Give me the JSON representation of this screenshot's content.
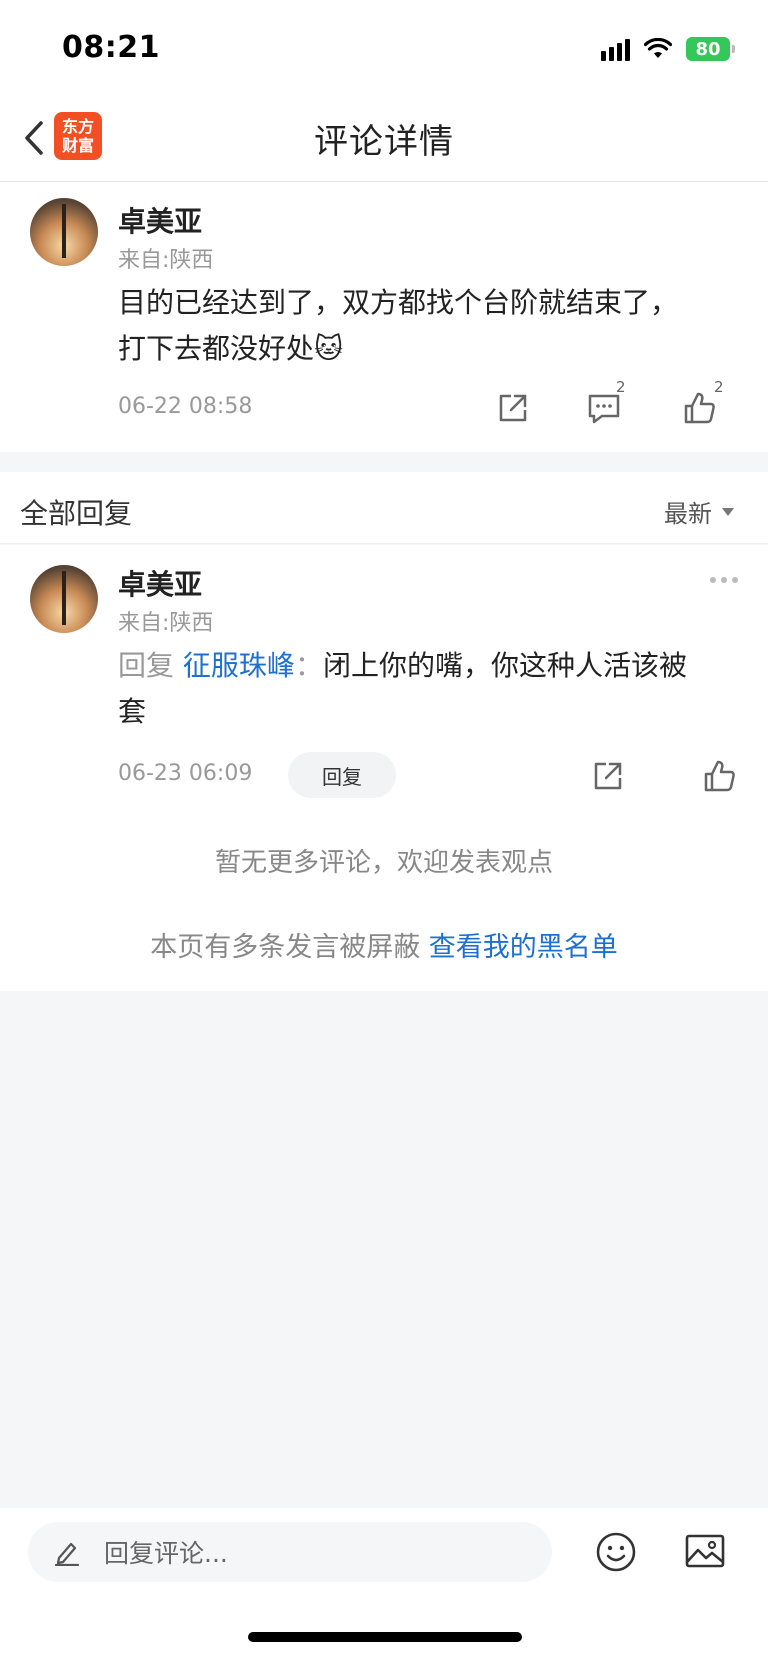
{
  "status_bar": {
    "time": "08:21",
    "battery": "80"
  },
  "nav": {
    "title": "评论详情",
    "logo_line1": "东方",
    "logo_line2": "财富"
  },
  "main_comment": {
    "username": "卓美亚",
    "location": "来自:陕西",
    "text_line1": "目的已经达到了，双方都找个台阶就结束了，",
    "text_line2": "打下去都没好处🐱",
    "time": "06-22 08:58",
    "comment_count": "2",
    "like_count": "2"
  },
  "replies": {
    "title": "全部回复",
    "sort_label": "最新",
    "items": [
      {
        "username": "卓美亚",
        "location": "来自:陕西",
        "reply_prefix": "回复",
        "reply_target": "征服珠峰",
        "reply_colon": "：",
        "text_line1": "闭上你的嘴，你这种人活该被",
        "text_line2": "套",
        "time": "06-23 06:09",
        "reply_button": "回复"
      }
    ],
    "no_more_text": "暂无更多评论，欢迎发表观点",
    "blocked_text": "本页有多条发言被屏蔽",
    "blacklist_link": "查看我的黑名单"
  },
  "bottom": {
    "input_placeholder": "回复评论..."
  },
  "colors": {
    "accent_link": "#1f6fd1",
    "logo_orange": "#f25022",
    "battery_green": "#34c759"
  },
  "icons": [
    "back-arrow-icon",
    "share-icon",
    "comment-icon",
    "thumbs-up-icon",
    "more-icon",
    "pencil-icon",
    "emoji-icon",
    "image-icon"
  ]
}
